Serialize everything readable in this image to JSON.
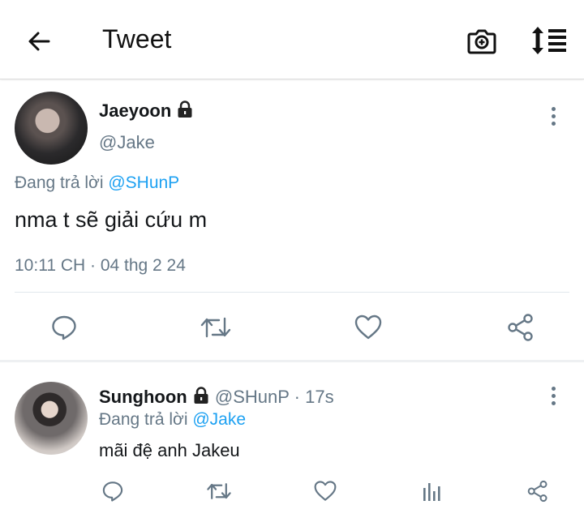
{
  "header": {
    "title": "Tweet",
    "back_icon": "arrow-left-icon",
    "camera_icon": "camera-plus-icon",
    "sort_icon": "sort-list-icon"
  },
  "main_tweet": {
    "display_name": "Jaeyoon",
    "handle": "@Jake",
    "protected_icon": "lock-icon",
    "reply_prefix": "Đang trả lời",
    "reply_to": "@SHunP",
    "text": "nma t sẽ giải cứu m",
    "timestamp": "10:11 CH · 04 thg 2 24",
    "actions": [
      "reply-icon",
      "retweet-icon",
      "like-icon",
      "share-icon"
    ]
  },
  "reply_tweet": {
    "display_name": "Sunghoon",
    "handle": "@SHunP",
    "age": "· 17s",
    "protected_icon": "lock-icon",
    "reply_prefix": "Đang trả lời",
    "reply_to": "@Jake",
    "text": "mãi đệ anh Jakeu",
    "actions": [
      "reply-icon",
      "retweet-icon",
      "like-icon",
      "analytics-icon",
      "share-icon"
    ]
  },
  "colors": {
    "accent": "#1da1f2",
    "secondary_text": "#657786",
    "icon": "#657786"
  }
}
